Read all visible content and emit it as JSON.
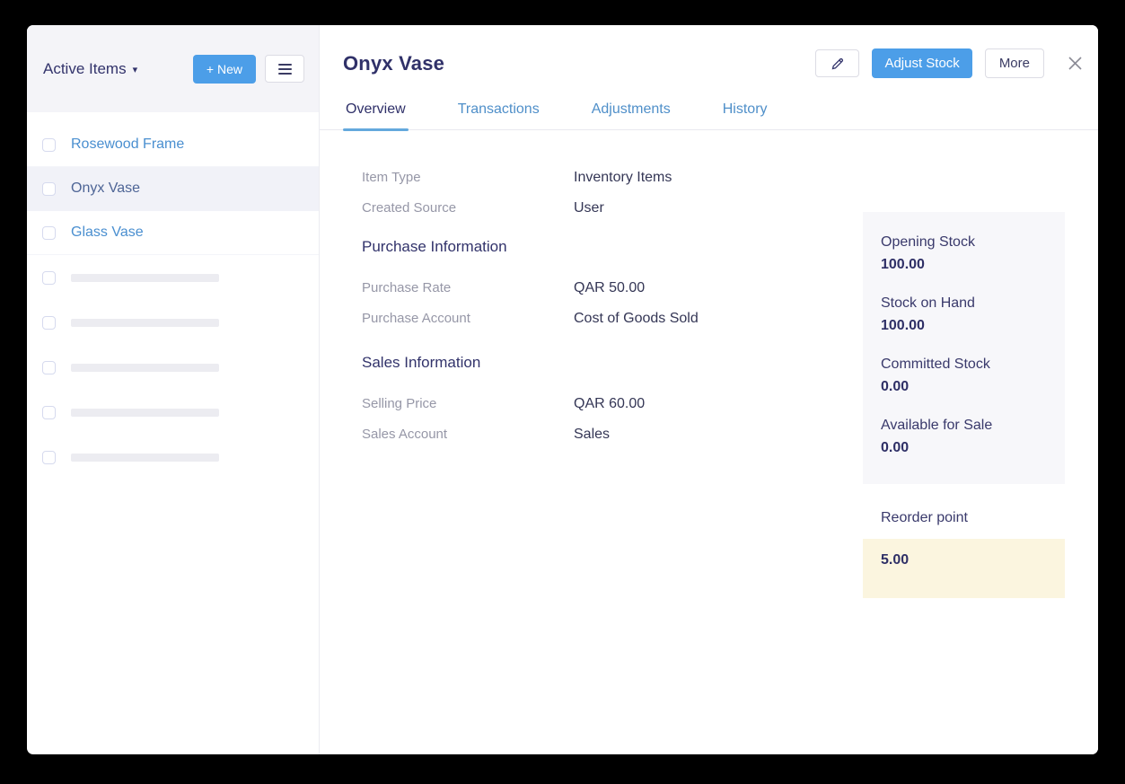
{
  "colors": {
    "accent_blue": "#4c9ee8",
    "link_blue": "#4a8fd0",
    "navy_text": "#303169",
    "label_gray": "#9697a7",
    "panel_gray": "#f7f7fa",
    "reorder_highlight": "#fbf5df"
  },
  "sidebar": {
    "header": {
      "title": "Active Items",
      "caret": "▾",
      "new_button_label": "+ New"
    },
    "items": [
      {
        "label": "Rosewood Frame",
        "selected": false
      },
      {
        "label": "Onyx Vase",
        "selected": true
      },
      {
        "label": "Glass Vase",
        "selected": false
      }
    ],
    "skeleton_row_count": 5
  },
  "header": {
    "title": "Onyx Vase",
    "adjust_stock_label": "Adjust Stock",
    "more_label": "More"
  },
  "tabs": [
    {
      "label": "Overview",
      "active": true
    },
    {
      "label": "Transactions",
      "active": false
    },
    {
      "label": "Adjustments",
      "active": false
    },
    {
      "label": "History",
      "active": false
    }
  ],
  "overview": {
    "fields": [
      {
        "label": "Item Type",
        "value": "Inventory Items"
      },
      {
        "label": "Created Source",
        "value": "User"
      }
    ],
    "purchase_section": {
      "title": "Purchase Information",
      "fields": [
        {
          "label": "Purchase Rate",
          "value": "QAR 50.00"
        },
        {
          "label": "Purchase Account",
          "value": "Cost of Goods Sold"
        }
      ]
    },
    "sales_section": {
      "title": "Sales Information",
      "fields": [
        {
          "label": "Selling Price",
          "value": "QAR 60.00"
        },
        {
          "label": "Sales Account",
          "value": "Sales"
        }
      ]
    }
  },
  "stock_panel": {
    "stats": [
      {
        "label": "Opening Stock",
        "value": "100.00"
      },
      {
        "label": "Stock on Hand",
        "value": "100.00"
      },
      {
        "label": "Committed Stock",
        "value": "0.00"
      },
      {
        "label": "Available for Sale",
        "value": "0.00"
      }
    ],
    "reorder": {
      "label": "Reorder point",
      "value": "5.00"
    }
  }
}
